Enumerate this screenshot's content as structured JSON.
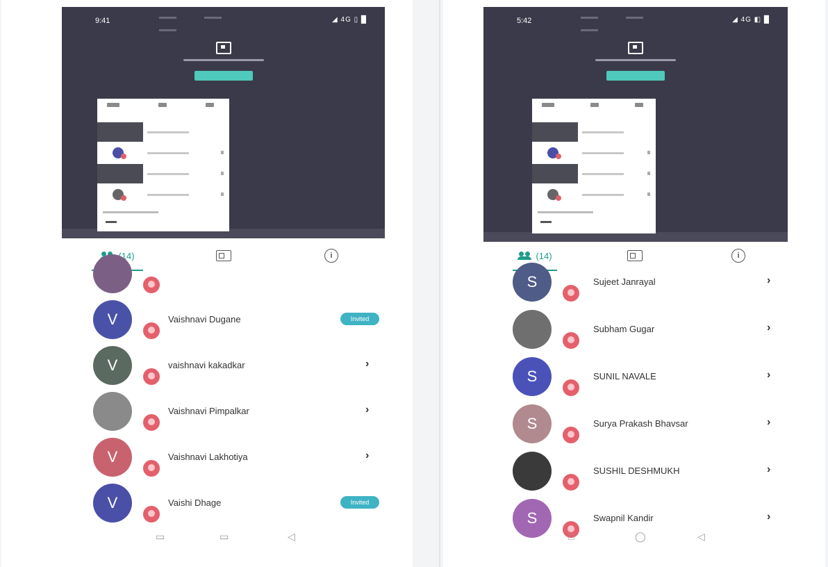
{
  "left": {
    "status": {
      "time": "9:41",
      "right": "◢ 4G ▯ █"
    },
    "tabs": {
      "participants_label": "(14)"
    },
    "participants": [
      {
        "initial": "",
        "name": "",
        "color": "#7c5f85",
        "action": ""
      },
      {
        "initial": "V",
        "name": "Vaishnavi Dugane",
        "color": "#4a52a8",
        "action": "pill",
        "pill_label": "Invited"
      },
      {
        "initial": "V",
        "name": "vaishnavi kakadkar",
        "color": "#5b6a60",
        "action": "chevron"
      },
      {
        "initial": "",
        "name": "Vaishnavi Pimpalkar",
        "color": "#8a8a8a",
        "action": "chevron"
      },
      {
        "initial": "V",
        "name": "Vaishnavi Lakhotiya",
        "color": "#c9626f",
        "action": "chevron"
      },
      {
        "initial": "V",
        "name": "Vaishi Dhage",
        "color": "#4a4fa8",
        "action": "pill",
        "pill_label": "Invited"
      }
    ],
    "nav": [
      "▭",
      "▭",
      "◁"
    ]
  },
  "right": {
    "status": {
      "time": "5:42",
      "right": "◢ 4G ◧ █"
    },
    "tabs": {
      "participants_label": "(14)"
    },
    "participants": [
      {
        "initial": "S",
        "name": "Sujeet Janrayal",
        "color": "#4f5c88",
        "action": "chevron"
      },
      {
        "initial": "",
        "name": "Subham Gugar",
        "color": "#6f6f6f",
        "action": "chevron"
      },
      {
        "initial": "S",
        "name": "SUNIL NAVALE",
        "color": "#4a52b8",
        "action": "chevron"
      },
      {
        "initial": "S",
        "name": "Surya Prakash Bhavsar",
        "color": "#b08a8f",
        "action": "chevron"
      },
      {
        "initial": "",
        "name": "SUSHIL DESHMUKH",
        "color": "#3a3a3a",
        "action": "chevron"
      },
      {
        "initial": "S",
        "name": "Swapnil Kandir",
        "color": "#a267b3",
        "action": "chevron"
      }
    ],
    "nav": [
      "□",
      "◯",
      "◁"
    ]
  },
  "chevron_glyph": "›",
  "colors": {
    "accent": "#1e9b8b",
    "badge": "#e4606c",
    "video_bg": "#3a3a4a"
  }
}
